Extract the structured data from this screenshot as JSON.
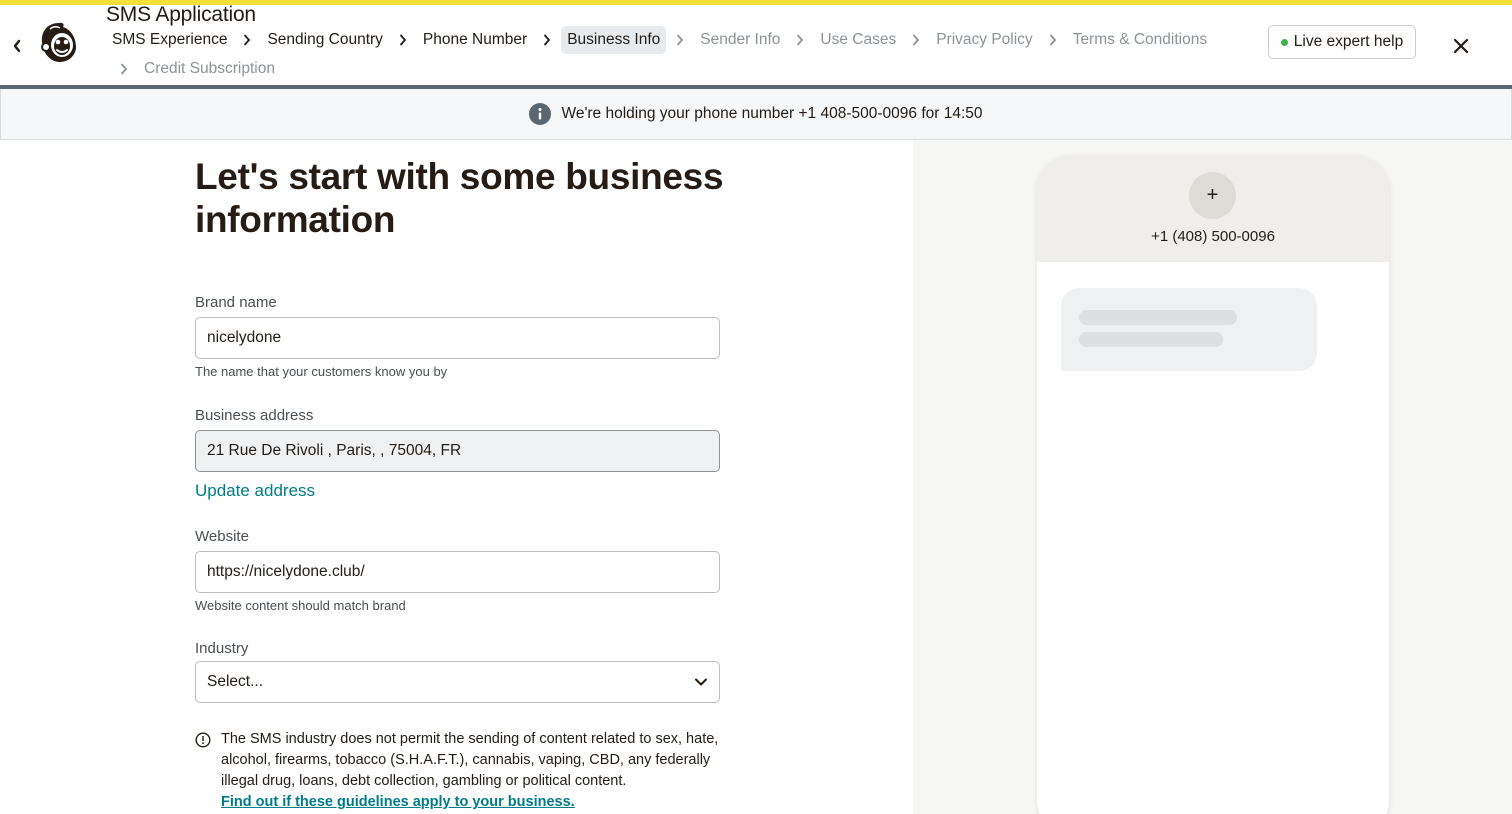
{
  "header": {
    "app_title": "SMS Application",
    "steps": [
      {
        "label": "SMS Experience",
        "state": "done"
      },
      {
        "label": "Sending Country",
        "state": "done"
      },
      {
        "label": "Phone Number",
        "state": "done"
      },
      {
        "label": "Business Info",
        "state": "current"
      },
      {
        "label": "Sender Info",
        "state": "todo"
      },
      {
        "label": "Use Cases",
        "state": "todo"
      },
      {
        "label": "Privacy Policy",
        "state": "todo"
      },
      {
        "label": "Terms & Conditions",
        "state": "todo"
      },
      {
        "label": "Credit Subscription",
        "state": "todo"
      }
    ],
    "help_label": "Live expert help",
    "icons": {
      "back": "chevron-left-icon",
      "close": "close-icon",
      "logo": "mailchimp-logo"
    }
  },
  "banner": {
    "text": "We're holding your phone number +1 408-500-0096 for 14:50",
    "icon": "info-icon"
  },
  "form": {
    "heading": "Let's start with some business information",
    "brand_name": {
      "label": "Brand name",
      "value": "nicelydone",
      "hint": "The name that your customers know you by"
    },
    "business_address": {
      "label": "Business address",
      "value": "21 Rue De Rivoli , Paris, , 75004, FR",
      "update_link": "Update address"
    },
    "website": {
      "label": "Website",
      "value": "https://nicelydone.club/",
      "hint": "Website content should match brand"
    },
    "industry": {
      "label": "Industry",
      "value": "Select..."
    },
    "notice": {
      "text": "The SMS industry does not permit the sending of content related to sex, hate, alcohol, firearms, tobacco (S.H.A.F.T.), cannabis, vaping, CBD, any federally illegal drug, loans, debt collection, gambling or political content.",
      "link": "Find out if these guidelines apply to your business."
    }
  },
  "preview": {
    "plus_label": "+",
    "phone_number": "+1 (408) 500-0096"
  },
  "colors": {
    "accent_bar": "#f5e03c",
    "link": "#007c89",
    "live_dot": "#40b34f"
  }
}
